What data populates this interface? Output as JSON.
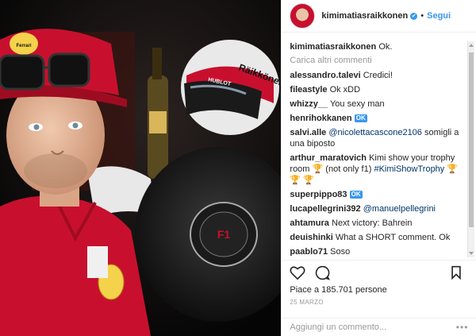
{
  "header": {
    "username": "kimimatiasraikkonen",
    "dot": "•",
    "follow_label": "Segui"
  },
  "caption": {
    "username": "kimimatiasraikkonen",
    "text": "Ok."
  },
  "load_more_label": "Carica altri commenti",
  "comments": [
    {
      "user": "alessandro.talevi",
      "text": "Credici!"
    },
    {
      "user": "fileastyle",
      "text": "Ok xDD"
    },
    {
      "user": "whizzy__",
      "text": "You sexy man"
    },
    {
      "user": "henrihokkanen",
      "text": "",
      "badge": "OK"
    },
    {
      "user": "salvi.alle",
      "mention": "@nicolettacascone2106",
      "text": "somigli a una biposto"
    },
    {
      "user": "arthur_maratovich",
      "text": "Kimi show your trophy room",
      "text2": "(not only f1)",
      "hashtag": "#KimiShowTrophy"
    },
    {
      "user": "superpippo83",
      "text": "",
      "badge": "OK"
    },
    {
      "user": "lucapellegrini392",
      "mention": "@manuelpellegrini",
      "text": ""
    },
    {
      "user": "ahtamura",
      "text": "Next victory: Bahrein"
    },
    {
      "user": "deuishinki",
      "text": "What a SHORT comment. Ok"
    },
    {
      "user": "paablo71",
      "text": "Soso"
    }
  ],
  "likes_text": "Piace a 185.701 persone",
  "date": "25 MARZO",
  "add_comment": {
    "placeholder": "Aggiungi un commento..."
  },
  "more_label": "•••",
  "photo": {
    "cap_text": "Ferrari",
    "helmet_text": "Räikkönen",
    "helmet_brand": "HUBLOT",
    "trophy_logo": "F1"
  },
  "colors": {
    "accent": "#3897f0",
    "ferrari_red": "#c8102e"
  }
}
